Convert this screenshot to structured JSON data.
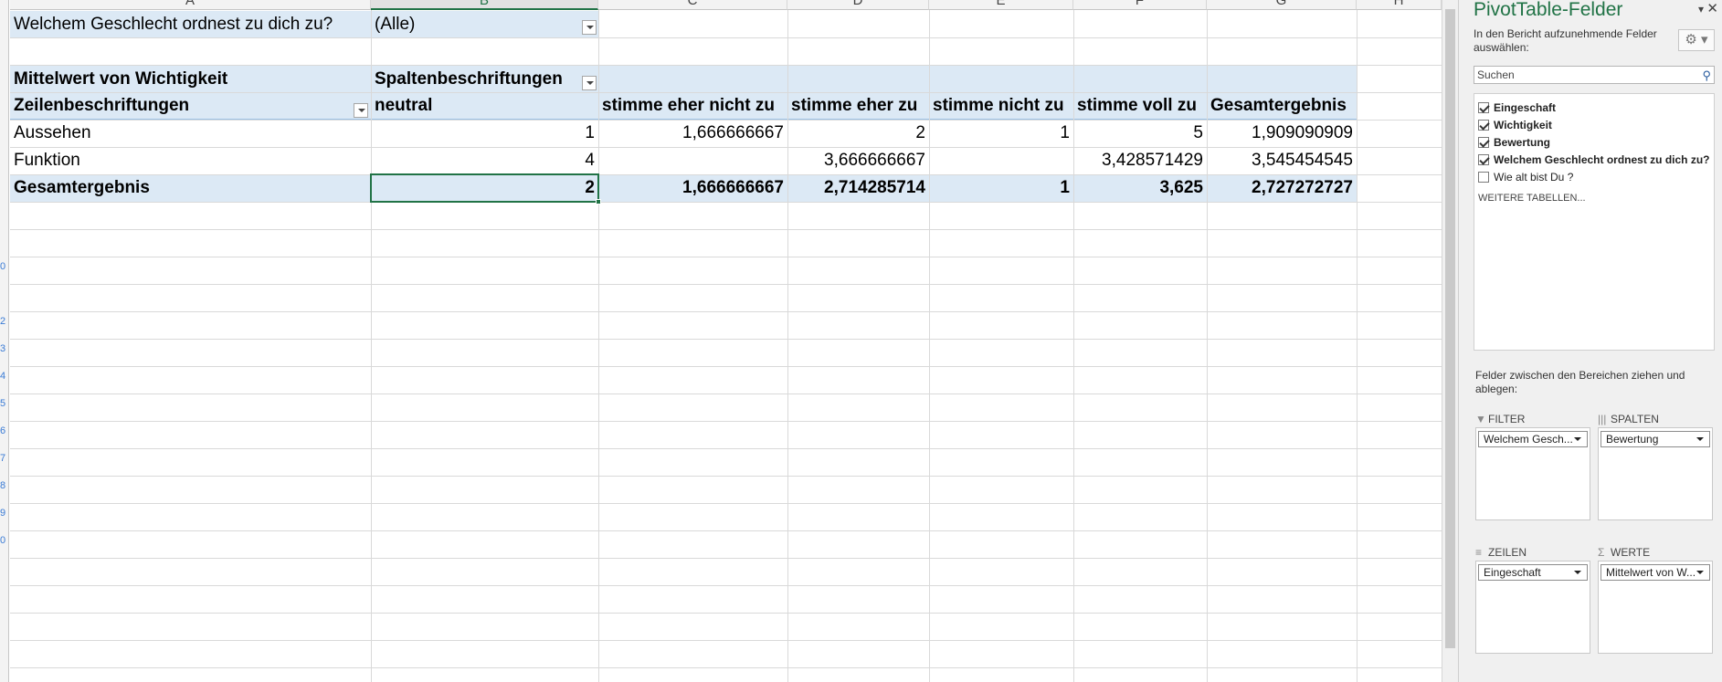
{
  "columns": [
    "A",
    "B",
    "C",
    "D",
    "E",
    "F",
    "G",
    "H"
  ],
  "row_numbers": [
    "0",
    "2",
    "3",
    "4",
    "5",
    "6",
    "7",
    "8",
    "9",
    "0"
  ],
  "filter": {
    "label": "Welchem Geschlecht ordnest zu dich zu?",
    "value": "(Alle)"
  },
  "pivot": {
    "value_caption": "Mittelwert von Wichtigkeit",
    "column_caption": "Spaltenbeschriftungen",
    "row_caption": "Zeilenbeschriftungen",
    "column_headers": [
      "neutral",
      "stimme eher nicht zu",
      "stimme eher zu",
      "stimme nicht zu",
      "stimme voll zu",
      "Gesamtergebnis"
    ],
    "rows": [
      {
        "label": "Aussehen",
        "values": [
          "1",
          "1,666666667",
          "2",
          "1",
          "5",
          "1,909090909"
        ]
      },
      {
        "label": "Funktion",
        "values": [
          "4",
          "",
          "3,666666667",
          "",
          "3,428571429",
          "3,545454545"
        ]
      }
    ],
    "total": {
      "label": "Gesamtergebnis",
      "values": [
        "2",
        "1,666666667",
        "2,714285714",
        "1",
        "3,625",
        "2,727272727"
      ]
    }
  },
  "panel": {
    "title": "PivotTable-Felder",
    "subtitle": "In den Bericht aufzunehmende Felder auswählen:",
    "search_placeholder": "Suchen",
    "fields": [
      {
        "label": "Eingeschaft",
        "checked": true
      },
      {
        "label": "Wichtigkeit",
        "checked": true
      },
      {
        "label": "Bewertung",
        "checked": true
      },
      {
        "label": "Welchem Geschlecht ordnest zu dich zu?",
        "checked": true
      },
      {
        "label": "Wie alt bist Du ?",
        "checked": false
      }
    ],
    "more_tables": "WEITERE TABELLEN...",
    "drag_hint": "Felder zwischen den Bereichen ziehen und ablegen:",
    "areas": {
      "filter": {
        "title": "FILTER",
        "item": "Welchem Gesch..."
      },
      "columns": {
        "title": "SPALTEN",
        "item": "Bewertung"
      },
      "rows": {
        "title": "ZEILEN",
        "item": "Eingeschaft"
      },
      "values": {
        "title": "WERTE",
        "item": "Mittelwert von W..."
      }
    }
  }
}
